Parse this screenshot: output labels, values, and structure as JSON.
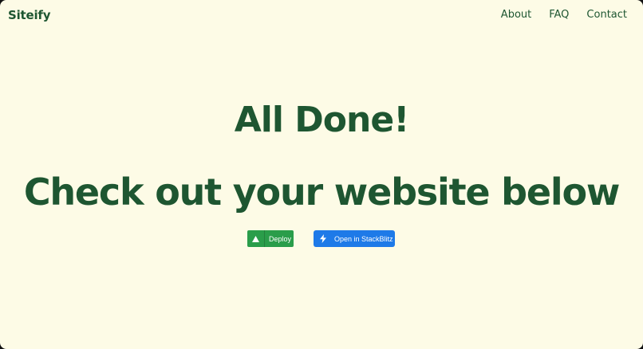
{
  "header": {
    "brand": "Siteify",
    "nav": [
      {
        "label": "About"
      },
      {
        "label": "FAQ"
      },
      {
        "label": "Contact"
      }
    ]
  },
  "main": {
    "heading": "All Done!",
    "subheading": "Check out your website below"
  },
  "actions": {
    "deploy_label": "Deploy",
    "deploy_icon": "triangle-icon",
    "stackblitz_label": "Open in StackBlitz",
    "stackblitz_icon": "lightning-bolt-icon"
  },
  "colors": {
    "background": "#fdfbe6",
    "text": "#1e5631",
    "deploy_button": "#2a9d4a",
    "stackblitz_button": "#1e7ae8"
  }
}
